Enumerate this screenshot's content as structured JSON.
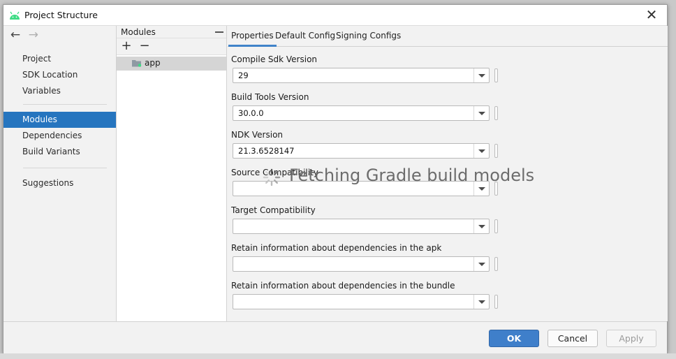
{
  "window": {
    "title": "Project Structure",
    "close_glyph": "✕",
    "title_icon": "android-icon"
  },
  "nav": {
    "back_glyph": "←",
    "forward_glyph": "→",
    "items": [
      {
        "label": "Project"
      },
      {
        "label": "SDK Location"
      },
      {
        "label": "Variables"
      },
      {
        "label": "Modules",
        "selected": true
      },
      {
        "label": "Dependencies"
      },
      {
        "label": "Build Variants"
      },
      {
        "label": "Suggestions"
      }
    ]
  },
  "modules": {
    "title": "Modules",
    "add_glyph": "+",
    "remove_glyph": "−",
    "items": [
      {
        "label": "app",
        "icon": "module-folder-icon"
      }
    ]
  },
  "tabs": [
    {
      "label": "Properties",
      "active": true
    },
    {
      "label": "Default Config"
    },
    {
      "label": "Signing Configs"
    }
  ],
  "fields": [
    {
      "label": "Compile Sdk Version",
      "value": "29"
    },
    {
      "label": "Build Tools Version",
      "value": "30.0.0"
    },
    {
      "label": "NDK Version",
      "value": "21.3.6528147"
    },
    {
      "label": "Source Compatibility",
      "value": ""
    },
    {
      "label": "Target Compatibility",
      "value": ""
    },
    {
      "label": "Retain information about dependencies in the apk",
      "value": ""
    },
    {
      "label": "Retain information about dependencies in the bundle",
      "value": ""
    }
  ],
  "loading": {
    "text": "Fetching Gradle build models",
    "icon": "spinner-icon"
  },
  "buttons": {
    "ok": "OK",
    "cancel": "Cancel",
    "apply": "Apply"
  },
  "colors": {
    "selection": "#2675bf",
    "primary_button": "#3f7fca",
    "active_tab_underline": "#4083c9",
    "android_green": "#3ddc84"
  }
}
